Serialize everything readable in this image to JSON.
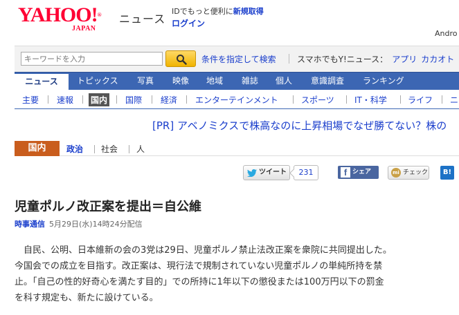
{
  "header": {
    "logo_text": "YAHOO!",
    "logo_sub": "JAPAN",
    "logo_reg": "®",
    "site_title": "ニュース",
    "id_promo_text": "IDでもっと便利に",
    "id_promo_link": "新規取得",
    "login_label": "ログイン",
    "user_name": "Andro"
  },
  "search": {
    "placeholder": "キーワードを入力",
    "advanced_label": "条件を指定して検索",
    "mobile_text": "スマホでもY!ニュース：",
    "mobile_links": [
      "アプリ",
      "カカオト"
    ]
  },
  "main_nav": {
    "tabs": [
      "ニュース",
      "トピックス",
      "写真",
      "映像",
      "地域",
      "雑誌",
      "個人",
      "意識調査",
      "ランキング"
    ]
  },
  "sub_nav": {
    "items": [
      "主要",
      "速報",
      "国内",
      "国際",
      "経済",
      "エンターテインメント",
      "スポーツ",
      "IT・科学",
      "ライフ",
      "ニ"
    ],
    "active": "国内"
  },
  "pr_ad": {
    "text": "[PR] アベノミクスで株高なのに上昇相場でなぜ勝てない？株の"
  },
  "category": {
    "current": "国内",
    "links": [
      "政治",
      "社会",
      "人"
    ]
  },
  "share": {
    "tweet_label": "ツイート",
    "tweet_count": "231",
    "facebook_label": "シェア",
    "facebook_glyph": "f",
    "check_label": "チェック",
    "check_glyph": "mi",
    "hatena_label": "B!"
  },
  "article": {
    "title": "児童ポルノ改正案を提出＝自公維",
    "source": "時事通信",
    "date": "5月29日(水)14時24分配信",
    "body": "自民、公明、日本維新の会の3党は29日、児童ポルノ禁止法改正案を衆院に共同提出した。\n今国会での成立を目指す。改正案は、現行法で規制されていない児童ポルノの単純所持を禁\n止。「自己の性的好奇心を満たす目的」での所持に1年以下の懲役または100万円以下の罰金\nを科す規定も、新たに設けている。"
  },
  "colors": {
    "yahoo_red": "#ff0033",
    "nav_blue": "#3c66b3",
    "link_blue": "#1a3ecc",
    "category_orange": "#c95d1d"
  }
}
